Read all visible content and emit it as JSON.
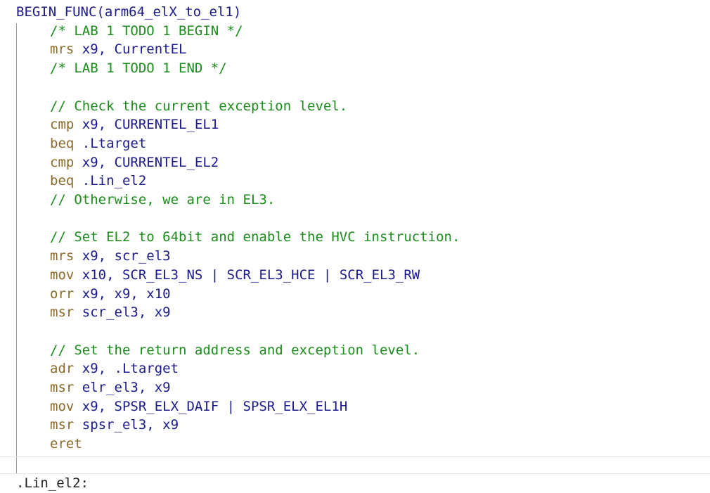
{
  "lines": [
    {
      "indent": 0,
      "parts": [
        [
          "tx",
          "BEGIN_FUNC(arm64_elX_to_el1)"
        ]
      ]
    },
    {
      "indent": 1,
      "parts": [
        [
          "cm",
          "/* LAB 1 TODO 1 BEGIN */"
        ]
      ]
    },
    {
      "indent": 1,
      "parts": [
        [
          "kw",
          "mrs"
        ],
        [
          "tx",
          " x9, CurrentEL"
        ]
      ]
    },
    {
      "indent": 1,
      "parts": [
        [
          "cm",
          "/* LAB 1 TODO 1 END */"
        ]
      ]
    },
    {
      "indent": 0,
      "parts": []
    },
    {
      "indent": 1,
      "parts": [
        [
          "cm",
          "// Check the current exception level."
        ]
      ]
    },
    {
      "indent": 1,
      "parts": [
        [
          "kw",
          "cmp"
        ],
        [
          "tx",
          " x9, CURRENTEL_EL1"
        ]
      ]
    },
    {
      "indent": 1,
      "parts": [
        [
          "kw",
          "beq"
        ],
        [
          "tx",
          " .Ltarget"
        ]
      ]
    },
    {
      "indent": 1,
      "parts": [
        [
          "kw",
          "cmp"
        ],
        [
          "tx",
          " x9, CURRENTEL_EL2"
        ]
      ]
    },
    {
      "indent": 1,
      "parts": [
        [
          "kw",
          "beq"
        ],
        [
          "tx",
          " .Lin_el2"
        ]
      ]
    },
    {
      "indent": 1,
      "parts": [
        [
          "cm",
          "// Otherwise, we are in EL3."
        ]
      ]
    },
    {
      "indent": 0,
      "parts": []
    },
    {
      "indent": 1,
      "parts": [
        [
          "cm",
          "// Set EL2 to 64bit and enable the HVC instruction."
        ]
      ]
    },
    {
      "indent": 1,
      "parts": [
        [
          "kw",
          "mrs"
        ],
        [
          "tx",
          " x9, scr_el3"
        ]
      ]
    },
    {
      "indent": 1,
      "parts": [
        [
          "kw",
          "mov"
        ],
        [
          "tx",
          " x10, SCR_EL3_NS | SCR_EL3_HCE | SCR_EL3_RW"
        ]
      ]
    },
    {
      "indent": 1,
      "parts": [
        [
          "kw",
          "orr"
        ],
        [
          "tx",
          " x9, x9, x10"
        ]
      ]
    },
    {
      "indent": 1,
      "parts": [
        [
          "kw",
          "msr"
        ],
        [
          "tx",
          " scr_el3, x9"
        ]
      ]
    },
    {
      "indent": 0,
      "parts": []
    },
    {
      "indent": 1,
      "parts": [
        [
          "cm",
          "// Set the return address and exception level."
        ]
      ]
    },
    {
      "indent": 1,
      "parts": [
        [
          "kw",
          "adr"
        ],
        [
          "tx",
          " x9, .Ltarget"
        ]
      ]
    },
    {
      "indent": 1,
      "parts": [
        [
          "kw",
          "msr"
        ],
        [
          "tx",
          " elr_el3, x9"
        ]
      ]
    },
    {
      "indent": 1,
      "parts": [
        [
          "kw",
          "mov"
        ],
        [
          "tx",
          " x9, SPSR_ELX_DAIF | SPSR_ELX_EL1H"
        ]
      ]
    },
    {
      "indent": 1,
      "parts": [
        [
          "kw",
          "msr"
        ],
        [
          "tx",
          " spsr_el3, x9"
        ]
      ]
    },
    {
      "indent": 1,
      "parts": [
        [
          "kw",
          "eret"
        ]
      ]
    },
    {
      "indent": 0,
      "parts": []
    },
    {
      "indent": 0,
      "parts": [
        [
          "plain",
          ".Lin_el2:"
        ]
      ]
    }
  ]
}
